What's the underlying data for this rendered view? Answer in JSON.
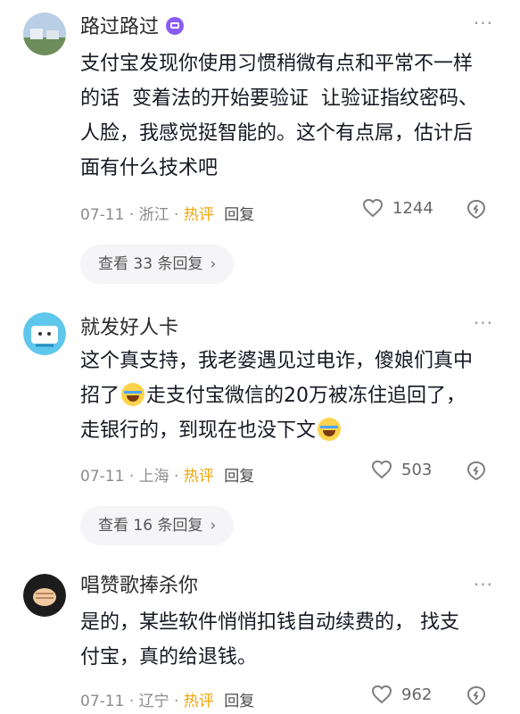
{
  "comments": [
    {
      "username": "路过路过",
      "body_lines": [
        "支付宝发现你使用习惯稍微有点和平常不一样",
        "的话  变着法的开始要验证  让验证指纹密码、",
        "人脸，我感觉挺智能的。这个有点屌，估计后",
        "面有什么技术吧"
      ],
      "date": "07-11",
      "location": "浙江",
      "hot_label": "热评",
      "reply_label": "回复",
      "likes": "1244",
      "expand_label": "查看 33 条回复"
    },
    {
      "username": "就发好人卡",
      "body_line1": "这个真支持，我老婆遇见过电诈，傻娘们真中",
      "body_line2_a": "招了",
      "body_line2_b": "走支付宝微信的20万被冻住追回了，",
      "body_line3": "走银行的，到现在也没下文",
      "date": "07-11",
      "location": "上海",
      "hot_label": "热评",
      "reply_label": "回复",
      "likes": "503",
      "expand_label": "查看 16 条回复"
    },
    {
      "username": "唱赞歌捧杀你",
      "body_lines": [
        "是的，某些软件悄悄扣钱自动续费的， 找支",
        "付宝，真的给退钱。"
      ],
      "date": "07-11",
      "location": "辽宁",
      "hot_label": "热评",
      "reply_label": "回复",
      "likes": "962"
    }
  ],
  "icons": {
    "more": "more-dots-icon",
    "like": "heart-icon",
    "dislike": "dislike-icon",
    "chevron": "chevron-right-icon",
    "emoji": "laugh-cry-emoji-icon"
  },
  "colors": {
    "hot": "#f0a500",
    "badge": "#8a5cf6",
    "expand_bg": "#f5f5f7"
  },
  "more_label": "···",
  "chevron_label": "›",
  "separator": "·"
}
